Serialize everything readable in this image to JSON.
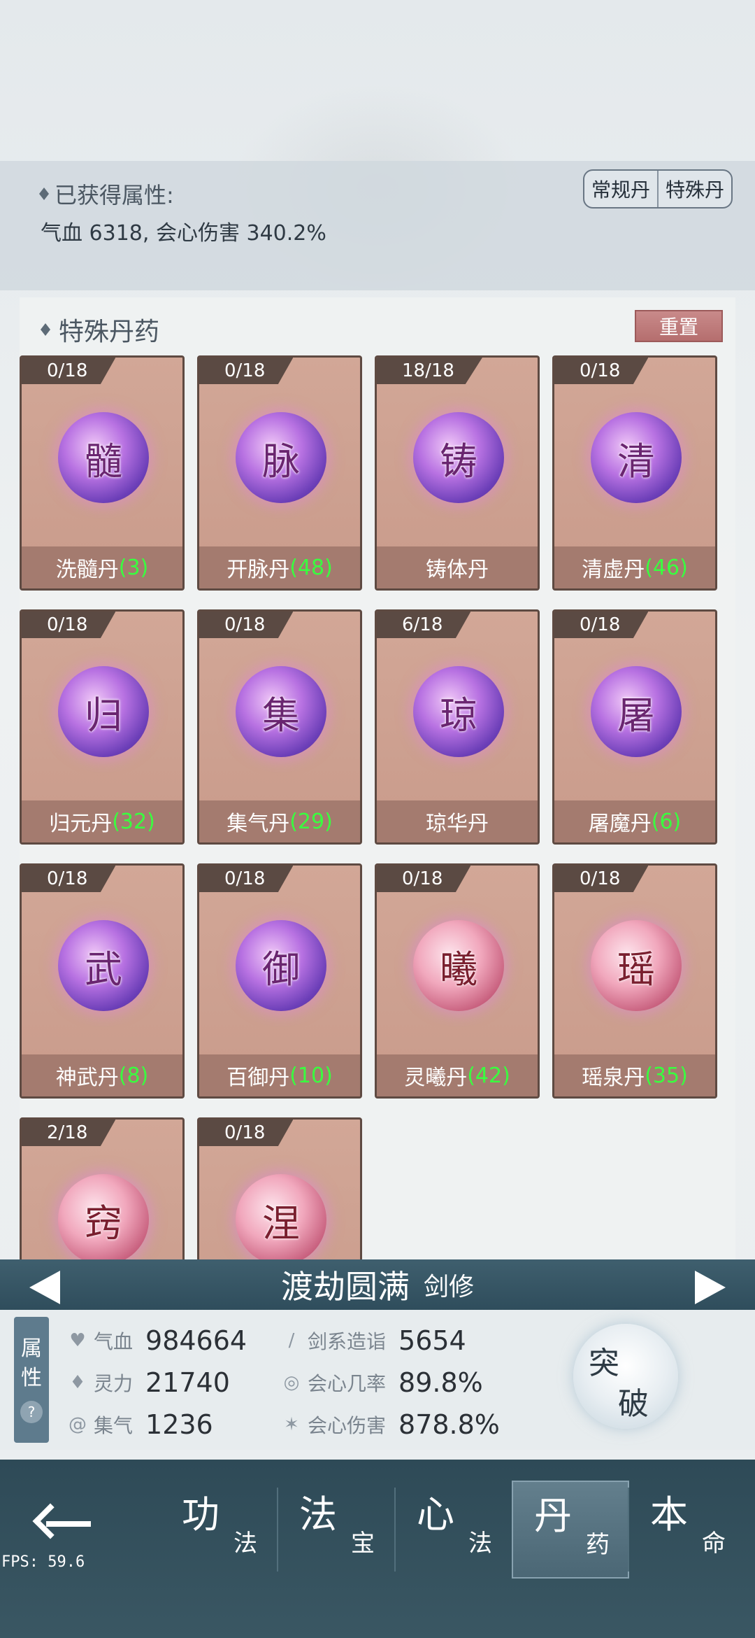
{
  "attributes": {
    "title": "已获得属性:",
    "value": "气血 6318, 会心伤害 340.2%"
  },
  "type_toggle": {
    "regular": "常规丹",
    "special": "特殊丹"
  },
  "special_pills": {
    "title": "特殊丹药",
    "reset_label": "重置",
    "items": [
      {
        "count": "0/18",
        "glyph": "髓",
        "name": "洗髓丹",
        "qty": "(3)",
        "orb": "purple"
      },
      {
        "count": "0/18",
        "glyph": "脉",
        "name": "开脉丹",
        "qty": "(48)",
        "orb": "purple"
      },
      {
        "count": "18/18",
        "glyph": "铸",
        "name": "铸体丹",
        "qty": "",
        "orb": "purple"
      },
      {
        "count": "0/18",
        "glyph": "清",
        "name": "清虚丹",
        "qty": "(46)",
        "orb": "purple"
      },
      {
        "count": "0/18",
        "glyph": "归",
        "name": "归元丹",
        "qty": "(32)",
        "orb": "purple"
      },
      {
        "count": "0/18",
        "glyph": "集",
        "name": "集气丹",
        "qty": "(29)",
        "orb": "purple"
      },
      {
        "count": "6/18",
        "glyph": "琼",
        "name": "琼华丹",
        "qty": "",
        "orb": "purple"
      },
      {
        "count": "0/18",
        "glyph": "屠",
        "name": "屠魔丹",
        "qty": "(6)",
        "orb": "purple"
      },
      {
        "count": "0/18",
        "glyph": "武",
        "name": "神武丹",
        "qty": "(8)",
        "orb": "purple"
      },
      {
        "count": "0/18",
        "glyph": "御",
        "name": "百御丹",
        "qty": "(10)",
        "orb": "purple"
      },
      {
        "count": "0/18",
        "glyph": "曦",
        "name": "灵曦丹",
        "qty": "(42)",
        "orb": "pink"
      },
      {
        "count": "0/18",
        "glyph": "瑶",
        "name": "瑶泉丹",
        "qty": "(35)",
        "orb": "pink"
      },
      {
        "count": "2/18",
        "glyph": "窍",
        "name": "",
        "qty": "",
        "orb": "pink"
      },
      {
        "count": "0/18",
        "glyph": "涅",
        "name": "",
        "qty": "",
        "orb": "pink"
      }
    ]
  },
  "realm": {
    "name": "渡劫圆满",
    "class": "剑修"
  },
  "stats": {
    "tab_label_1": "属",
    "tab_label_2": "性",
    "help": "?",
    "qixue_label": "气血",
    "qixue_value": "984664",
    "lingli_label": "灵力",
    "lingli_value": "21740",
    "jiqi_label": "集气",
    "jiqi_value": "1236",
    "jianxi_label": "剑系造诣",
    "jianxi_value": "5654",
    "huixin_rate_label": "会心几率",
    "huixin_rate_value": "89.8%",
    "huixin_dmg_label": "会心伤害",
    "huixin_dmg_value": "878.8%",
    "breakthrough_1": "突",
    "breakthrough_2": "破"
  },
  "nav": {
    "tabs": [
      {
        "big": "功",
        "small": "法"
      },
      {
        "big": "法",
        "small": "宝"
      },
      {
        "big": "心",
        "small": "法"
      },
      {
        "big": "丹",
        "small": "药"
      },
      {
        "big": "本",
        "small": "命"
      }
    ],
    "active_index": 3
  },
  "fps": "FPS: 59.6"
}
